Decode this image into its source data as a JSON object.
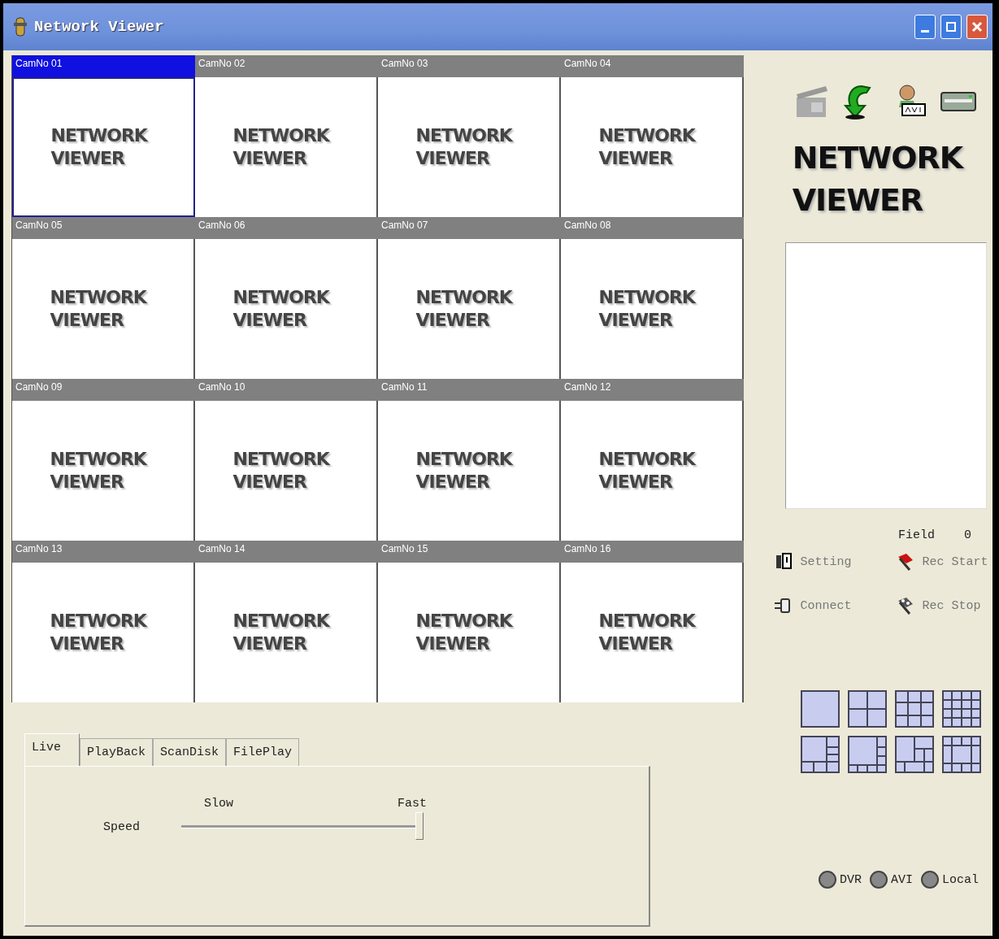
{
  "window": {
    "title": "Network Viewer"
  },
  "cameras": [
    {
      "label": "CamNo 01",
      "selected": true,
      "logo": [
        "NETWORK",
        "VIEWER"
      ]
    },
    {
      "label": "CamNo 02",
      "selected": false,
      "logo": [
        "NETWORK",
        "VIEWER"
      ]
    },
    {
      "label": "CamNo 03",
      "selected": false,
      "logo": [
        "NETWORK",
        "VIEWER"
      ]
    },
    {
      "label": "CamNo 04",
      "selected": false,
      "logo": [
        "NETWORK",
        "VIEWER"
      ]
    },
    {
      "label": "CamNo 05",
      "selected": false,
      "logo": [
        "NETWORK",
        "VIEWER"
      ]
    },
    {
      "label": "CamNo 06",
      "selected": false,
      "logo": [
        "NETWORK",
        "VIEWER"
      ]
    },
    {
      "label": "CamNo 07",
      "selected": false,
      "logo": [
        "NETWORK",
        "VIEWER"
      ]
    },
    {
      "label": "CamNo 08",
      "selected": false,
      "logo": [
        "NETWORK",
        "VIEWER"
      ]
    },
    {
      "label": "CamNo 09",
      "selected": false,
      "logo": [
        "NETWORK",
        "VIEWER"
      ]
    },
    {
      "label": "CamNo 10",
      "selected": false,
      "logo": [
        "NETWORK",
        "VIEWER"
      ]
    },
    {
      "label": "CamNo 11",
      "selected": false,
      "logo": [
        "NETWORK",
        "VIEWER"
      ]
    },
    {
      "label": "CamNo 12",
      "selected": false,
      "logo": [
        "NETWORK",
        "VIEWER"
      ]
    },
    {
      "label": "CamNo 13",
      "selected": false,
      "logo": [
        "NETWORK",
        "VIEWER"
      ]
    },
    {
      "label": "CamNo 14",
      "selected": false,
      "logo": [
        "NETWORK",
        "VIEWER"
      ]
    },
    {
      "label": "CamNo 15",
      "selected": false,
      "logo": [
        "NETWORK",
        "VIEWER"
      ]
    },
    {
      "label": "CamNo 16",
      "selected": false,
      "logo": [
        "NETWORK",
        "VIEWER"
      ]
    }
  ],
  "side_logo": [
    "NETWORK",
    "VIEWER"
  ],
  "field": {
    "label": "Field",
    "value": "0"
  },
  "actions": [
    {
      "label": "Setting",
      "kind": "setting"
    },
    {
      "label": "Rec Start",
      "kind": "recstart"
    },
    {
      "label": "Connect",
      "kind": "connect"
    },
    {
      "label": "Rec Stop",
      "kind": "recstop"
    }
  ],
  "tabs": [
    {
      "label": "Live",
      "selected": true
    },
    {
      "label": "PlayBack",
      "selected": false
    },
    {
      "label": "ScanDisk",
      "selected": false
    },
    {
      "label": "FilePlay",
      "selected": false
    }
  ],
  "speed": {
    "label": "Speed",
    "min_label": "Slow",
    "max_label": "Fast",
    "level": 1.0
  },
  "sources": [
    {
      "label": "DVR",
      "selected": false
    },
    {
      "label": "AVI",
      "selected": false
    },
    {
      "label": "Local",
      "selected": false
    }
  ]
}
